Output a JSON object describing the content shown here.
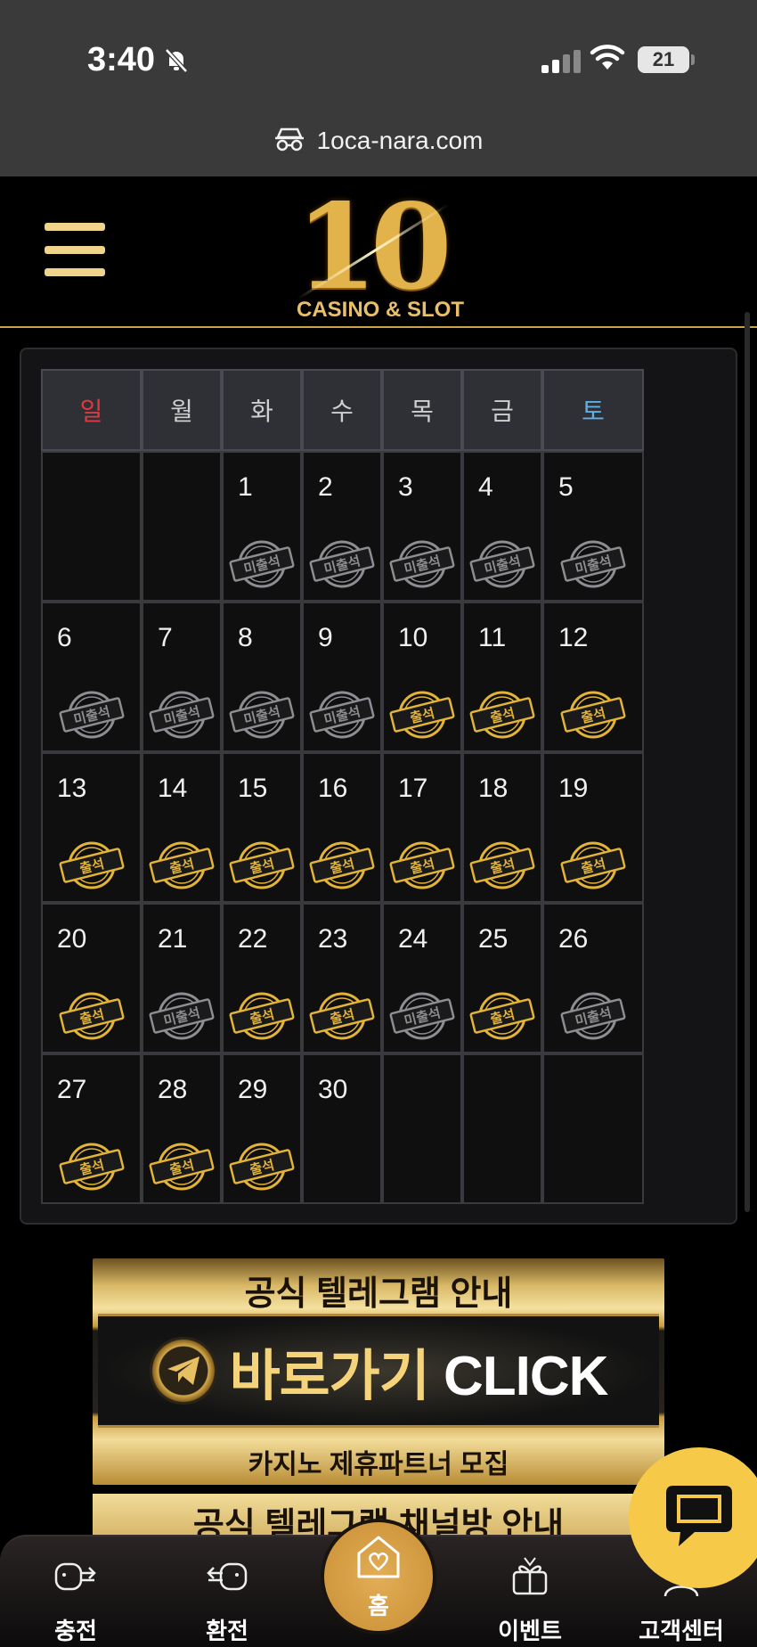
{
  "status_bar": {
    "time": "3:40",
    "battery": "21"
  },
  "browser": {
    "url": "1oca-nara.com"
  },
  "header": {
    "logo_number": "10",
    "logo_subtitle": "CASINO & SLOT"
  },
  "calendar": {
    "weekdays": [
      "일",
      "월",
      "화",
      "수",
      "목",
      "금",
      "토"
    ],
    "weekday_colors": [
      "#e0393e",
      "#cfcfcf",
      "#cfcfcf",
      "#cfcfcf",
      "#cfcfcf",
      "#cfcfcf",
      "#5fb0e6"
    ],
    "stamp_labels": {
      "attended": "출석",
      "absent": "미출석"
    },
    "stamp_colors": {
      "attended": "#e3b437",
      "absent": "#8d8d92"
    },
    "weeks": [
      [
        {
          "day": "",
          "status": ""
        },
        {
          "day": "",
          "status": ""
        },
        {
          "day": "1",
          "status": "absent"
        },
        {
          "day": "2",
          "status": "absent"
        },
        {
          "day": "3",
          "status": "absent"
        },
        {
          "day": "4",
          "status": "absent"
        },
        {
          "day": "5",
          "status": "absent"
        }
      ],
      [
        {
          "day": "6",
          "status": "absent"
        },
        {
          "day": "7",
          "status": "absent"
        },
        {
          "day": "8",
          "status": "absent"
        },
        {
          "day": "9",
          "status": "absent"
        },
        {
          "day": "10",
          "status": "attended"
        },
        {
          "day": "11",
          "status": "attended"
        },
        {
          "day": "12",
          "status": "attended"
        }
      ],
      [
        {
          "day": "13",
          "status": "attended"
        },
        {
          "day": "14",
          "status": "attended"
        },
        {
          "day": "15",
          "status": "attended"
        },
        {
          "day": "16",
          "status": "attended"
        },
        {
          "day": "17",
          "status": "attended"
        },
        {
          "day": "18",
          "status": "attended"
        },
        {
          "day": "19",
          "status": "attended"
        }
      ],
      [
        {
          "day": "20",
          "status": "attended"
        },
        {
          "day": "21",
          "status": "absent"
        },
        {
          "day": "22",
          "status": "attended"
        },
        {
          "day": "23",
          "status": "attended"
        },
        {
          "day": "24",
          "status": "absent"
        },
        {
          "day": "25",
          "status": "attended"
        },
        {
          "day": "26",
          "status": "absent"
        }
      ],
      [
        {
          "day": "27",
          "status": "attended"
        },
        {
          "day": "28",
          "status": "attended"
        },
        {
          "day": "29",
          "status": "attended"
        },
        {
          "day": "30",
          "status": ""
        },
        {
          "day": "",
          "status": ""
        },
        {
          "day": "",
          "status": ""
        },
        {
          "day": "",
          "status": ""
        }
      ]
    ]
  },
  "banner": {
    "top_text": "공식 텔레그램 안내",
    "click_text_gold": "바로가기",
    "click_text_white": "CLICK",
    "bottom_text": "카지노 제휴파트너 모집",
    "second_banner_text": "공식 텔레그램 채널방 안내"
  },
  "bottom_nav": {
    "items": [
      {
        "label": "충전",
        "icon": "deposit-icon"
      },
      {
        "label": "환전",
        "icon": "withdraw-icon"
      },
      {
        "label": "홈",
        "icon": "home-icon"
      },
      {
        "label": "이벤트",
        "icon": "gift-icon"
      },
      {
        "label": "고객센터",
        "icon": "support-icon"
      }
    ]
  },
  "colors": {
    "accent_gold": "#c9a24a",
    "chat_button": "#f7c948"
  }
}
